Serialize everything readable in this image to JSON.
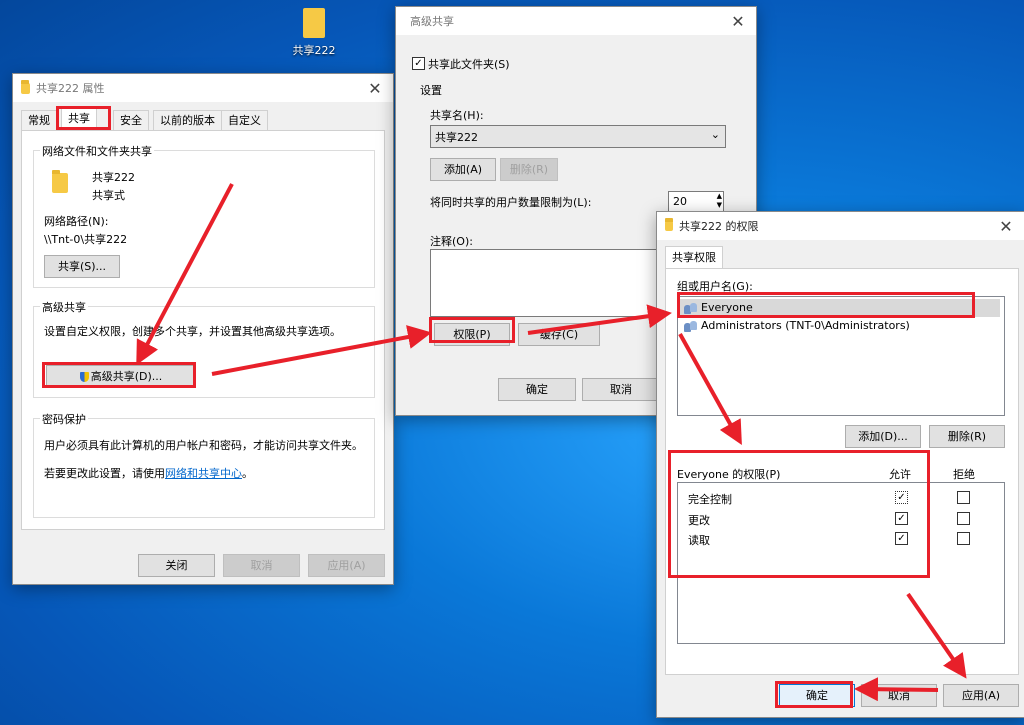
{
  "desktop": {
    "folder_label": "共享222"
  },
  "properties": {
    "title": "共享222 属性",
    "tabs": [
      "常规",
      "共享",
      "安全",
      "以前的版本",
      "自定义"
    ],
    "net_group_title": "网络文件和文件夹共享",
    "share_name": "共享222",
    "share_state": "共享式",
    "net_path_label": "网络路径(N):",
    "net_path": "\\\\Tnt-0\\共享222",
    "share_button": "共享(S)...",
    "adv_group_title": "高级共享",
    "adv_desc": "设置自定义权限，创建多个共享，并设置其他高级共享选项。",
    "adv_button": "高级共享(D)...",
    "pwd_group_title": "密码保护",
    "pwd_desc": "用户必须具有此计算机的用户帐户和密码，才能访问共享文件夹。",
    "pwd_change_prefix": "若要更改此设置，请使用",
    "pwd_link": "网络和共享中心",
    "pwd_change_suffix": "。",
    "close_button": "关闭",
    "cancel_button": "取消",
    "apply_button": "应用(A)"
  },
  "advanced": {
    "title": "高级共享",
    "share_checkbox_label": "共享此文件夹(S)",
    "settings_label": "设置",
    "share_name_label": "共享名(H):",
    "share_name_value": "共享222",
    "add_button": "添加(A)",
    "remove_button": "删除(R)",
    "limit_label": "将同时共享的用户数量限制为(L):",
    "limit_value": "20",
    "comment_label": "注释(O):",
    "permissions_button": "权限(P)",
    "cache_button": "缓存(C)",
    "ok_button": "确定",
    "cancel_button": "取消"
  },
  "permissions": {
    "title": "共享222 的权限",
    "tab": "共享权限",
    "group_label": "组或用户名(G):",
    "users": [
      "Everyone",
      "Administrators (TNT-0\\Administrators)"
    ],
    "add_button": "添加(D)...",
    "remove_button": "删除(R)",
    "perm_header": "Everyone 的权限(P)",
    "allow_header": "允许",
    "deny_header": "拒绝",
    "rows": [
      {
        "name": "完全控制",
        "allow": true,
        "deny": false
      },
      {
        "name": "更改",
        "allow": true,
        "deny": false
      },
      {
        "name": "读取",
        "allow": true,
        "deny": false
      }
    ],
    "ok_button": "确定",
    "cancel_button": "取消",
    "apply_button": "应用(A)"
  },
  "colors": {
    "highlight": "#e8202a",
    "accent": "#0078d7"
  }
}
